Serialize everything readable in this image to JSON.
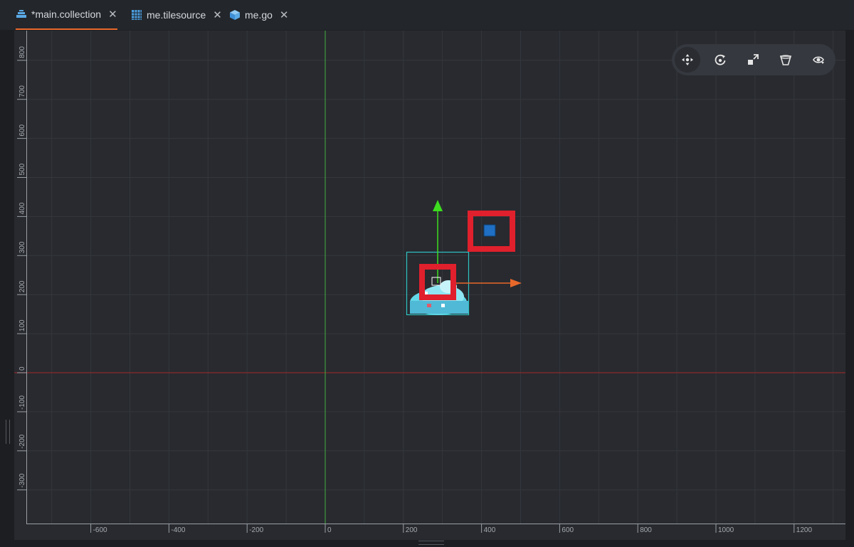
{
  "tabs": [
    {
      "label": "*main.collection",
      "icon": "collection-icon",
      "active": true
    },
    {
      "label": "me.tilesource",
      "icon": "tilesource-icon",
      "active": false
    },
    {
      "label": "me.go",
      "icon": "game-object-icon",
      "active": false
    }
  ],
  "toolbar": {
    "tools": [
      {
        "name": "move-tool",
        "icon": "move-icon",
        "active": true
      },
      {
        "name": "rotate-tool",
        "icon": "rotate-icon",
        "active": false
      },
      {
        "name": "scale-tool",
        "icon": "scale-icon",
        "active": false
      },
      {
        "name": "perspective-tool",
        "icon": "perspective-icon",
        "active": false
      },
      {
        "name": "visibility-tool",
        "icon": "visibility-icon",
        "active": false
      }
    ]
  },
  "ruler": {
    "x_ticks": [
      "-600",
      "-400",
      "-200",
      "0",
      "200",
      "400",
      "600",
      "800",
      "1000",
      "1200"
    ],
    "y_ticks": [
      "800",
      "700",
      "600",
      "500",
      "400",
      "300",
      "200",
      "100",
      "0",
      "-100",
      "-200",
      "-300"
    ]
  },
  "colors": {
    "accent": "#e8682a",
    "x_axis": "#8b2a2a",
    "y_axis": "#3f9a3f",
    "selection": "#2fc3c3",
    "highlight": "#e0202c",
    "gizmo_y": "#3ddc1f",
    "gizmo_x": "#e8682a",
    "handle": "#1f6fc4"
  }
}
